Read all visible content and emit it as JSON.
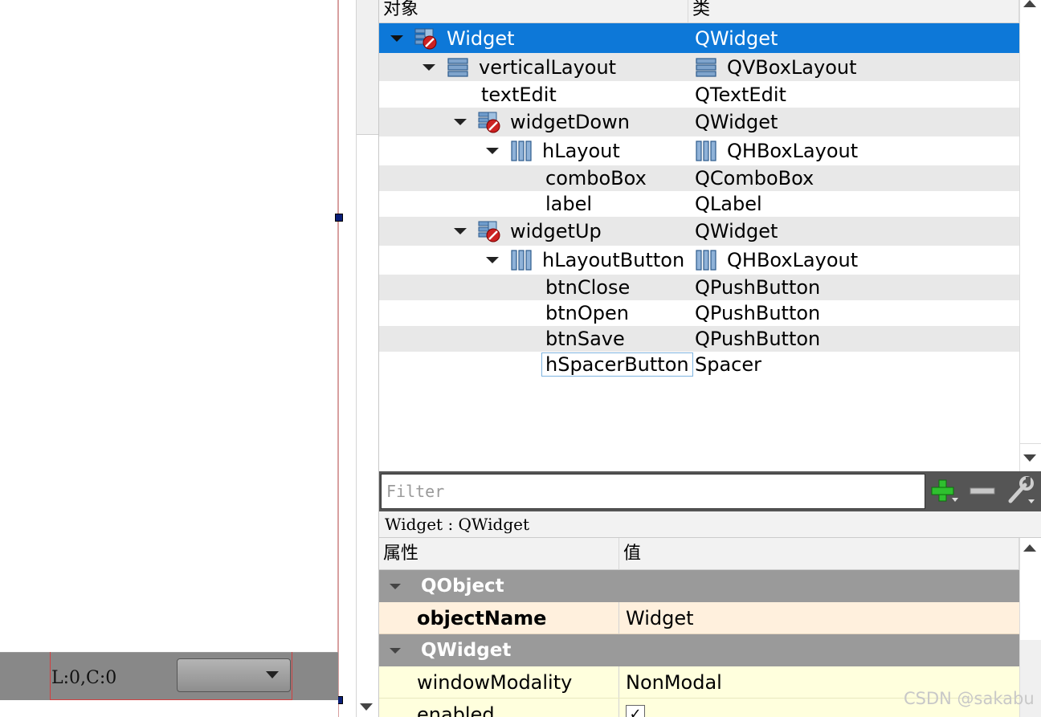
{
  "form": {
    "position_label": "L:0,C:0"
  },
  "object_inspector": {
    "headers": {
      "object": "对象",
      "class": "类"
    },
    "rows": [
      {
        "name": "Widget",
        "class": "QWidget",
        "icon": "widget-icon",
        "class_icon": ""
      },
      {
        "name": "verticalLayout",
        "class": "QVBoxLayout",
        "icon": "vbox-layout-icon",
        "class_icon": "vbox-layout-icon"
      },
      {
        "name": "textEdit",
        "class": "QTextEdit",
        "icon": "",
        "class_icon": ""
      },
      {
        "name": "widgetDown",
        "class": "QWidget",
        "icon": "widget-icon",
        "class_icon": ""
      },
      {
        "name": "hLayout",
        "class": "QHBoxLayout",
        "icon": "hbox-layout-icon",
        "class_icon": "hbox-layout-icon"
      },
      {
        "name": "comboBox",
        "class": "QComboBox",
        "icon": "",
        "class_icon": ""
      },
      {
        "name": "label",
        "class": "QLabel",
        "icon": "",
        "class_icon": ""
      },
      {
        "name": "widgetUp",
        "class": "QWidget",
        "icon": "widget-icon",
        "class_icon": ""
      },
      {
        "name": "hLayoutButton",
        "class": "QHBoxLayout",
        "icon": "hbox-layout-icon",
        "class_icon": "hbox-layout-icon"
      },
      {
        "name": "btnClose",
        "class": "QPushButton",
        "icon": "",
        "class_icon": ""
      },
      {
        "name": "btnOpen",
        "class": "QPushButton",
        "icon": "",
        "class_icon": ""
      },
      {
        "name": "btnSave",
        "class": "QPushButton",
        "icon": "",
        "class_icon": ""
      },
      {
        "name": "hSpacerButton",
        "class": "Spacer",
        "icon": "",
        "class_icon": ""
      }
    ],
    "selected_row": "Widget",
    "colors": {
      "selection": "#0d78d8",
      "alt_row": "#e8e8e8"
    }
  },
  "filter": {
    "placeholder": "Filter",
    "buttons": [
      "plus-icon",
      "minus-icon",
      "wrench-icon"
    ]
  },
  "property_editor": {
    "class_label": "Widget : QWidget",
    "headers": {
      "property": "属性",
      "value": "值"
    },
    "groups": [
      {
        "name": "QObject",
        "properties": [
          {
            "name": "objectName",
            "value": "Widget",
            "bold": true,
            "color": "#fff0dd"
          }
        ]
      },
      {
        "name": "QWidget",
        "properties": [
          {
            "name": "windowModality",
            "value": "NonModal",
            "bold": false,
            "color": "#ffffdd"
          },
          {
            "name": "enabled",
            "value": "✓",
            "bold": false,
            "color": "#ffffdd"
          }
        ]
      }
    ],
    "colors": {
      "group": "#9a9a9a"
    }
  },
  "watermark": "CSDN @sakabu"
}
